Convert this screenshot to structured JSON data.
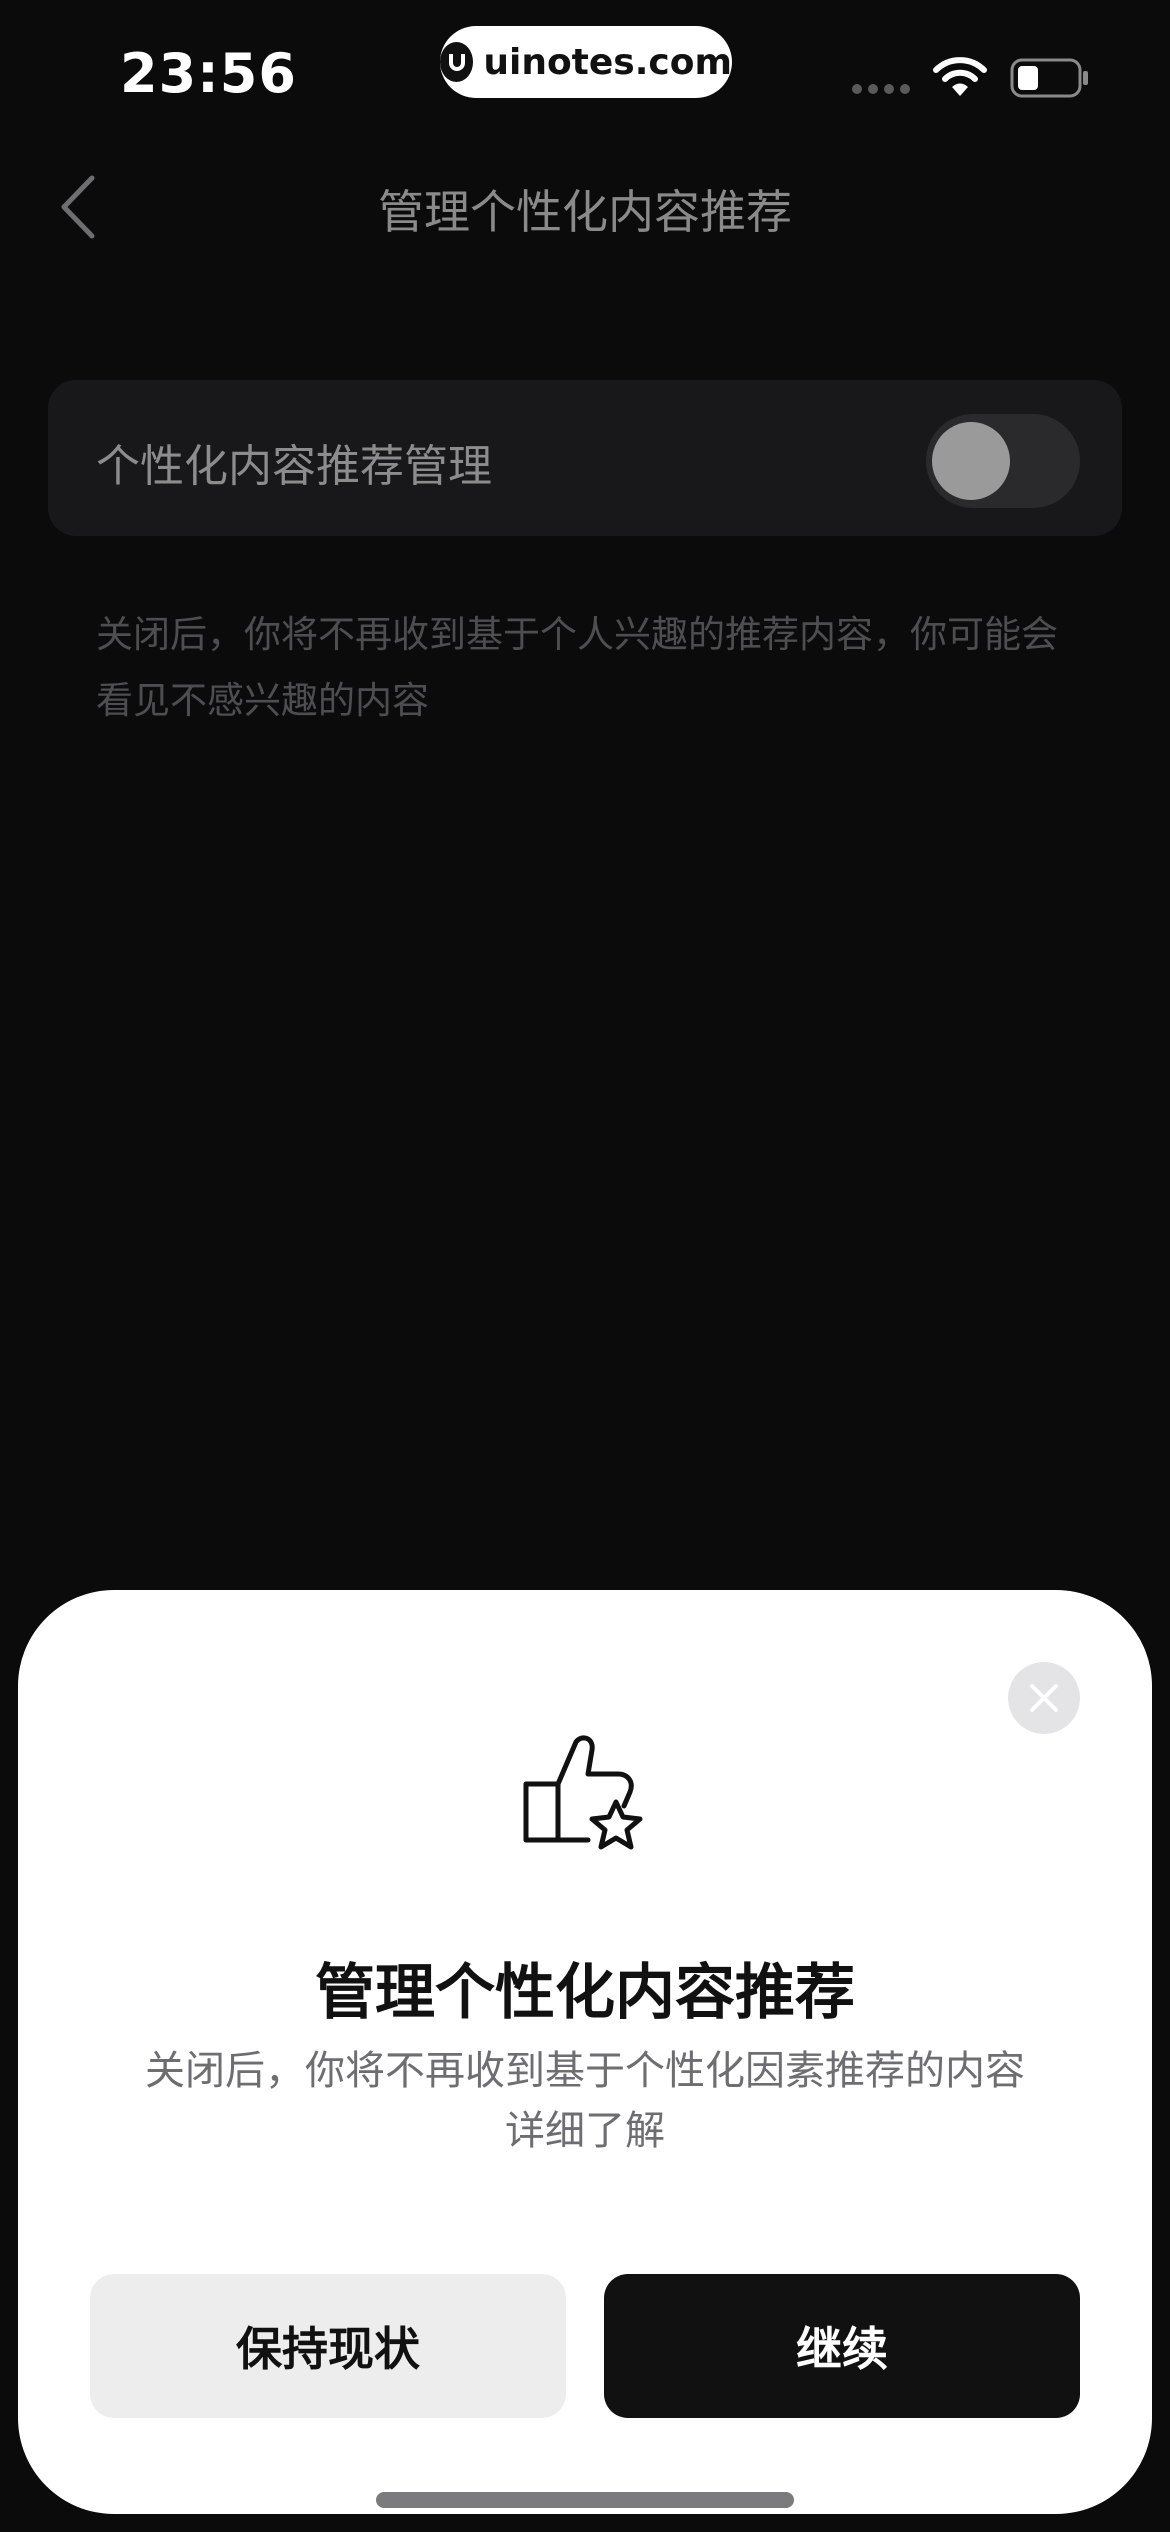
{
  "status_bar": {
    "time": "23:56",
    "watermark": "uinotes.com"
  },
  "nav": {
    "title": "管理个性化内容推荐"
  },
  "setting": {
    "label": "个性化内容推荐管理",
    "toggle_on": false,
    "description": "关闭后，你将不再收到基于个人兴趣的推荐内容，你可能会看见不感兴趣的内容"
  },
  "sheet": {
    "title": "管理个性化内容推荐",
    "description": "关闭后，你将不再收到基于个性化因素推荐的内容",
    "learn_more": "详细了解",
    "keep_label": "保持现状",
    "continue_label": "继续"
  }
}
